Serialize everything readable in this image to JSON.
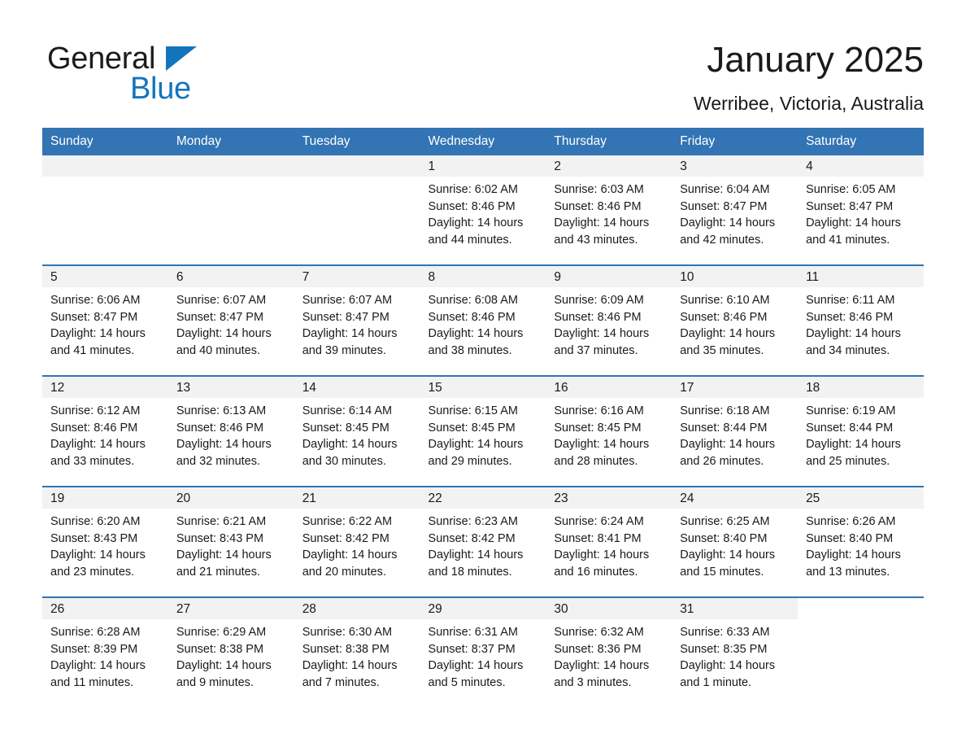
{
  "brand": {
    "name_part1": "General",
    "name_part2": "Blue",
    "accent_color": "#1275bc"
  },
  "header": {
    "title": "January 2025",
    "subtitle": "Werribee, Victoria, Australia"
  },
  "theme": {
    "header_blue": "#3274b4",
    "daynum_band": "#f2f2f2",
    "text": "#1a1a1a"
  },
  "weekday_headers": [
    "Sunday",
    "Monday",
    "Tuesday",
    "Wednesday",
    "Thursday",
    "Friday",
    "Saturday"
  ],
  "labels": {
    "sunrise_prefix": "Sunrise:",
    "sunset_prefix": "Sunset:",
    "daylight_prefix": "Daylight:"
  },
  "weeks": [
    [
      {
        "day": "",
        "line1": "",
        "line2": "",
        "line3": "",
        "line4": "",
        "empty": true
      },
      {
        "day": "",
        "line1": "",
        "line2": "",
        "line3": "",
        "line4": "",
        "empty": true
      },
      {
        "day": "",
        "line1": "",
        "line2": "",
        "line3": "",
        "line4": "",
        "empty": true
      },
      {
        "day": "1",
        "line1": "Sunrise: 6:02 AM",
        "line2": "Sunset: 8:46 PM",
        "line3": "Daylight: 14 hours",
        "line4": "and 44 minutes.",
        "empty": false
      },
      {
        "day": "2",
        "line1": "Sunrise: 6:03 AM",
        "line2": "Sunset: 8:46 PM",
        "line3": "Daylight: 14 hours",
        "line4": "and 43 minutes.",
        "empty": false
      },
      {
        "day": "3",
        "line1": "Sunrise: 6:04 AM",
        "line2": "Sunset: 8:47 PM",
        "line3": "Daylight: 14 hours",
        "line4": "and 42 minutes.",
        "empty": false
      },
      {
        "day": "4",
        "line1": "Sunrise: 6:05 AM",
        "line2": "Sunset: 8:47 PM",
        "line3": "Daylight: 14 hours",
        "line4": "and 41 minutes.",
        "empty": false
      }
    ],
    [
      {
        "day": "5",
        "line1": "Sunrise: 6:06 AM",
        "line2": "Sunset: 8:47 PM",
        "line3": "Daylight: 14 hours",
        "line4": "and 41 minutes.",
        "empty": false
      },
      {
        "day": "6",
        "line1": "Sunrise: 6:07 AM",
        "line2": "Sunset: 8:47 PM",
        "line3": "Daylight: 14 hours",
        "line4": "and 40 minutes.",
        "empty": false
      },
      {
        "day": "7",
        "line1": "Sunrise: 6:07 AM",
        "line2": "Sunset: 8:47 PM",
        "line3": "Daylight: 14 hours",
        "line4": "and 39 minutes.",
        "empty": false
      },
      {
        "day": "8",
        "line1": "Sunrise: 6:08 AM",
        "line2": "Sunset: 8:46 PM",
        "line3": "Daylight: 14 hours",
        "line4": "and 38 minutes.",
        "empty": false
      },
      {
        "day": "9",
        "line1": "Sunrise: 6:09 AM",
        "line2": "Sunset: 8:46 PM",
        "line3": "Daylight: 14 hours",
        "line4": "and 37 minutes.",
        "empty": false
      },
      {
        "day": "10",
        "line1": "Sunrise: 6:10 AM",
        "line2": "Sunset: 8:46 PM",
        "line3": "Daylight: 14 hours",
        "line4": "and 35 minutes.",
        "empty": false
      },
      {
        "day": "11",
        "line1": "Sunrise: 6:11 AM",
        "line2": "Sunset: 8:46 PM",
        "line3": "Daylight: 14 hours",
        "line4": "and 34 minutes.",
        "empty": false
      }
    ],
    [
      {
        "day": "12",
        "line1": "Sunrise: 6:12 AM",
        "line2": "Sunset: 8:46 PM",
        "line3": "Daylight: 14 hours",
        "line4": "and 33 minutes.",
        "empty": false
      },
      {
        "day": "13",
        "line1": "Sunrise: 6:13 AM",
        "line2": "Sunset: 8:46 PM",
        "line3": "Daylight: 14 hours",
        "line4": "and 32 minutes.",
        "empty": false
      },
      {
        "day": "14",
        "line1": "Sunrise: 6:14 AM",
        "line2": "Sunset: 8:45 PM",
        "line3": "Daylight: 14 hours",
        "line4": "and 30 minutes.",
        "empty": false
      },
      {
        "day": "15",
        "line1": "Sunrise: 6:15 AM",
        "line2": "Sunset: 8:45 PM",
        "line3": "Daylight: 14 hours",
        "line4": "and 29 minutes.",
        "empty": false
      },
      {
        "day": "16",
        "line1": "Sunrise: 6:16 AM",
        "line2": "Sunset: 8:45 PM",
        "line3": "Daylight: 14 hours",
        "line4": "and 28 minutes.",
        "empty": false
      },
      {
        "day": "17",
        "line1": "Sunrise: 6:18 AM",
        "line2": "Sunset: 8:44 PM",
        "line3": "Daylight: 14 hours",
        "line4": "and 26 minutes.",
        "empty": false
      },
      {
        "day": "18",
        "line1": "Sunrise: 6:19 AM",
        "line2": "Sunset: 8:44 PM",
        "line3": "Daylight: 14 hours",
        "line4": "and 25 minutes.",
        "empty": false
      }
    ],
    [
      {
        "day": "19",
        "line1": "Sunrise: 6:20 AM",
        "line2": "Sunset: 8:43 PM",
        "line3": "Daylight: 14 hours",
        "line4": "and 23 minutes.",
        "empty": false
      },
      {
        "day": "20",
        "line1": "Sunrise: 6:21 AM",
        "line2": "Sunset: 8:43 PM",
        "line3": "Daylight: 14 hours",
        "line4": "and 21 minutes.",
        "empty": false
      },
      {
        "day": "21",
        "line1": "Sunrise: 6:22 AM",
        "line2": "Sunset: 8:42 PM",
        "line3": "Daylight: 14 hours",
        "line4": "and 20 minutes.",
        "empty": false
      },
      {
        "day": "22",
        "line1": "Sunrise: 6:23 AM",
        "line2": "Sunset: 8:42 PM",
        "line3": "Daylight: 14 hours",
        "line4": "and 18 minutes.",
        "empty": false
      },
      {
        "day": "23",
        "line1": "Sunrise: 6:24 AM",
        "line2": "Sunset: 8:41 PM",
        "line3": "Daylight: 14 hours",
        "line4": "and 16 minutes.",
        "empty": false
      },
      {
        "day": "24",
        "line1": "Sunrise: 6:25 AM",
        "line2": "Sunset: 8:40 PM",
        "line3": "Daylight: 14 hours",
        "line4": "and 15 minutes.",
        "empty": false
      },
      {
        "day": "25",
        "line1": "Sunrise: 6:26 AM",
        "line2": "Sunset: 8:40 PM",
        "line3": "Daylight: 14 hours",
        "line4": "and 13 minutes.",
        "empty": false
      }
    ],
    [
      {
        "day": "26",
        "line1": "Sunrise: 6:28 AM",
        "line2": "Sunset: 8:39 PM",
        "line3": "Daylight: 14 hours",
        "line4": "and 11 minutes.",
        "empty": false
      },
      {
        "day": "27",
        "line1": "Sunrise: 6:29 AM",
        "line2": "Sunset: 8:38 PM",
        "line3": "Daylight: 14 hours",
        "line4": "and 9 minutes.",
        "empty": false
      },
      {
        "day": "28",
        "line1": "Sunrise: 6:30 AM",
        "line2": "Sunset: 8:38 PM",
        "line3": "Daylight: 14 hours",
        "line4": "and 7 minutes.",
        "empty": false
      },
      {
        "day": "29",
        "line1": "Sunrise: 6:31 AM",
        "line2": "Sunset: 8:37 PM",
        "line3": "Daylight: 14 hours",
        "line4": "and 5 minutes.",
        "empty": false
      },
      {
        "day": "30",
        "line1": "Sunrise: 6:32 AM",
        "line2": "Sunset: 8:36 PM",
        "line3": "Daylight: 14 hours",
        "line4": "and 3 minutes.",
        "empty": false
      },
      {
        "day": "31",
        "line1": "Sunrise: 6:33 AM",
        "line2": "Sunset: 8:35 PM",
        "line3": "Daylight: 14 hours",
        "line4": "and 1 minute.",
        "empty": false
      },
      {
        "day": "",
        "line1": "",
        "line2": "",
        "line3": "",
        "line4": "",
        "empty": true,
        "trailing": true
      }
    ]
  ]
}
